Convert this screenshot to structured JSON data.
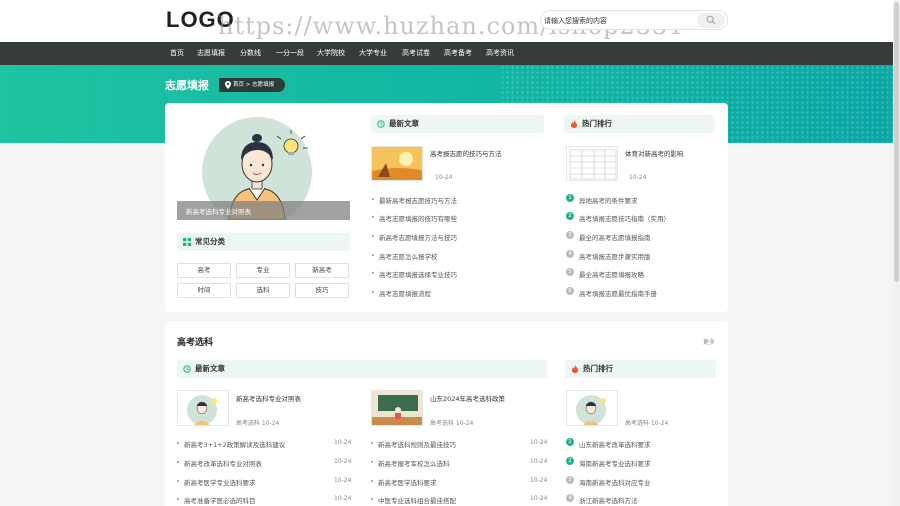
{
  "header": {
    "logo": "LOGO",
    "watermark": "https://www.huzhan.com/ishop2331",
    "search_placeholder": "请输入您搜索的内容"
  },
  "nav": [
    "首页",
    "志愿填报",
    "分数线",
    "一分一段",
    "大学院校",
    "大学专业",
    "高考试卷",
    "高考备考",
    "高考资讯"
  ],
  "banner": {
    "title": "志愿填报",
    "breadcrumb": "首页 > 志愿填报"
  },
  "profile": {
    "caption": "新高考选科专业对照表"
  },
  "categories": {
    "title": "常见分类",
    "tags": [
      "高考",
      "专业",
      "新高考",
      "时间",
      "选科",
      "技巧"
    ]
  },
  "latest1": {
    "title": "最新文章",
    "featured_title": "高考报志愿的技巧与方法",
    "featured_date": "10-24",
    "items": [
      "最新高考报志愿技巧与方法",
      "高考志愿填报的技巧有哪些",
      "新高考志愿填报方法与技巧",
      "高考志愿怎么报学校",
      "高考志愿填报选择专业技巧",
      "高考志愿填报流程"
    ]
  },
  "hot1": {
    "title": "热门排行",
    "featured_title": "体育对新高考的影响",
    "featured_date": "10-24",
    "items": [
      {
        "num": "1",
        "text": "异地高考的条件要求"
      },
      {
        "num": "2",
        "text": "高考填报志愿技巧指南（实用）"
      },
      {
        "num": "3",
        "text": "最全的高考志愿填报指南"
      },
      {
        "num": "4",
        "text": "高考填报志愿步骤实用版"
      },
      {
        "num": "5",
        "text": "最全高考志愿填报攻略"
      },
      {
        "num": "6",
        "text": "高考填报志愿最优指南手册"
      }
    ]
  },
  "section2": {
    "title": "高考选科",
    "more": "更多",
    "latest_title": "最新文章",
    "hot_title": "热门排行",
    "col1": {
      "featured_title": "新高考选科专业对照表",
      "featured_meta": "高考选科   10-24",
      "items": [
        {
          "text": "新高考3+1+2政策解读及选科建议",
          "date": "10-24"
        },
        {
          "text": "新高考改革选科专业对照表",
          "date": "10-24"
        },
        {
          "text": "新高考医学专业选科要求",
          "date": "10-24"
        },
        {
          "text": "高考准备学医必选的科目",
          "date": "10-24"
        }
      ]
    },
    "col2": {
      "featured_title": "山东2024年高考选科政策",
      "featured_meta": "高考选科   10-24",
      "items": [
        {
          "text": "新高考选科规则及最佳技巧",
          "date": "10-24"
        },
        {
          "text": "新高考报考军校怎么选科",
          "date": "10-24"
        },
        {
          "text": "新高考医学选科要求",
          "date": "10-24"
        },
        {
          "text": "中医专业选科组合最佳搭配",
          "date": "10-24"
        }
      ]
    },
    "col3": {
      "featured_meta": "高考选科   10-24",
      "items": [
        {
          "num": "1",
          "text": "山东新高考改革选科要求"
        },
        {
          "num": "2",
          "text": "海南新高考专业选科要求"
        },
        {
          "num": "3",
          "text": "海南新高考选科对应专业"
        },
        {
          "num": "4",
          "text": "浙江新高考选科方法"
        }
      ]
    }
  },
  "colors": {
    "accent": "#1db28e",
    "nav_bg": "#363c3c",
    "banner": "#13b8a3"
  }
}
